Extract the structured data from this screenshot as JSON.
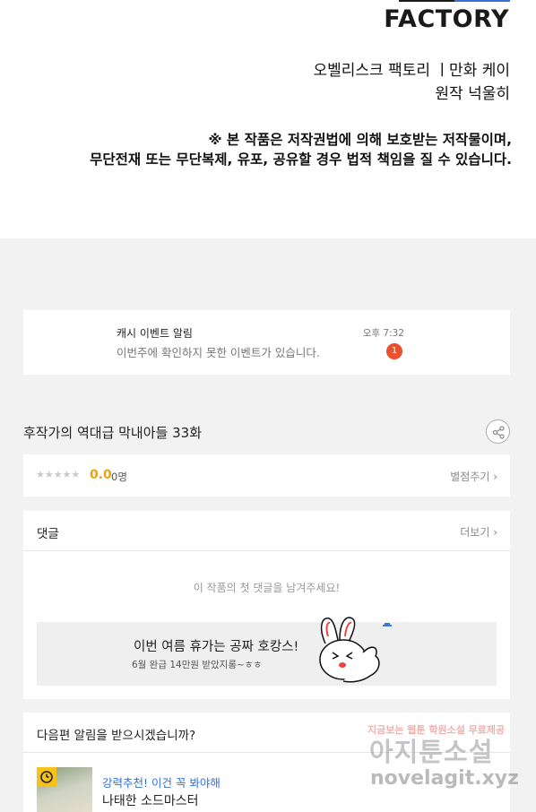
{
  "credits": {
    "logo": "FACTORY",
    "line1": "오벨리스크 팩토리 ㅣ만화 케이",
    "line2": "원작 넉울히",
    "notice1": "※ 본 작품은 저작권법에 의해 보호받는 저작물이며,",
    "notice2": "무단전재 또는 무단복제, 유포, 공유할 경우 법적 책임을 질 수 있습니다."
  },
  "event": {
    "title": "캐시 이벤트 알림",
    "subtitle": "이번주에 확인하지 못한 이벤트가 있습니다.",
    "time": "오후 7:32",
    "badge": "1"
  },
  "episode": {
    "title": "후작가의 역대급 막내아들 33화"
  },
  "rating": {
    "stars": "★★★★★",
    "score": "0.0",
    "count": "0명",
    "rate_link": "별점주기 ›"
  },
  "comments": {
    "title": "댓글",
    "more": "더보기 ›",
    "empty": "이 작품의 첫 댓글을 남겨주세요!",
    "promo_title": "이번 여름 휴가는 공짜 호캉스!",
    "promo_sub": "6월 완급 14만원 받았지롱~ㅎㅎ"
  },
  "next": {
    "title": "다음편 알림을 받으시겠습니까?",
    "rec_label": "강력추천! 이건 꼭 봐야해",
    "rec_name": "나태한 소드마스터"
  },
  "watermark": {
    "top": "지금보는 웹툰 학원소설 무료제공",
    "mid": "아지툰소설",
    "url": "novelagit.xyz"
  },
  "colors": {
    "accent_orange": "#e8512d",
    "score_yellow": "#e8a317",
    "link_blue": "#2f6fe0"
  }
}
